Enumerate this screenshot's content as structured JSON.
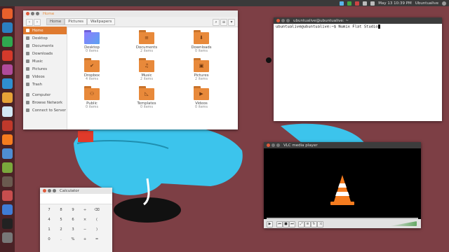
{
  "topbar": {
    "time": "May 13 10:39 PM",
    "user": "Ubuntualive"
  },
  "icons": {
    "launcher": [
      "dash-icon",
      "files-icon",
      "chrome-icon",
      "terminal-icon",
      "writer-icon",
      "calc-icon",
      "impress-icon",
      "software-icon",
      "settings-icon",
      "vlc-icon",
      "screenshot-icon",
      "shotwell-icon",
      "gimp-icon",
      "calculator-icon",
      "inkscape-icon",
      "terminal-icon",
      "trash-icon"
    ],
    "colors": [
      "#e8602c",
      "#2b7fc0",
      "#2fa84f",
      "#d43a2b",
      "#b04b9b",
      "#2f8fcf",
      "#e6a237",
      "#d2e7f4",
      "#c0392b",
      "#f57c1f",
      "#4f8dd2",
      "#7aa83c",
      "#6a5a4f",
      "#c74e4e",
      "#3f7cd6",
      "#222222",
      "#777777"
    ]
  },
  "files": {
    "title": "Home",
    "crumbs": [
      "Home",
      "Pictures",
      "Wallpapers"
    ],
    "sidebar": [
      {
        "label": "Home",
        "icon": "home-icon",
        "selected": true
      },
      {
        "label": "Desktop",
        "icon": "desktop-icon"
      },
      {
        "label": "Documents",
        "icon": "documents-icon"
      },
      {
        "label": "Downloads",
        "icon": "downloads-icon"
      },
      {
        "label": "Music",
        "icon": "music-icon"
      },
      {
        "label": "Pictures",
        "icon": "pictures-icon"
      },
      {
        "label": "Videos",
        "icon": "videos-icon"
      },
      {
        "label": "Trash",
        "icon": "trash-icon"
      },
      {
        "label": "Computer",
        "icon": "computer-icon"
      },
      {
        "label": "Browse Network",
        "icon": "network-icon"
      },
      {
        "label": "Connect to Server",
        "icon": "server-icon"
      }
    ],
    "items": [
      {
        "name": "Desktop",
        "sub": "0 items",
        "icon": "desktop-folder-icon",
        "glyph": ""
      },
      {
        "name": "Documents",
        "sub": "2 items",
        "icon": "documents-folder-icon",
        "glyph": "≡"
      },
      {
        "name": "Downloads",
        "sub": "0 items",
        "icon": "downloads-folder-icon",
        "glyph": "⬇"
      },
      {
        "name": "Dropbox",
        "sub": "4 items",
        "icon": "dropbox-folder-icon",
        "glyph": "✔"
      },
      {
        "name": "Music",
        "sub": "2 items",
        "icon": "music-folder-icon",
        "glyph": "♫"
      },
      {
        "name": "Pictures",
        "sub": "2 items",
        "icon": "pictures-folder-icon",
        "glyph": "▣"
      },
      {
        "name": "Public",
        "sub": "0 items",
        "icon": "public-folder-icon",
        "glyph": "⚇"
      },
      {
        "name": "Templates",
        "sub": "0 items",
        "icon": "templates-folder-icon",
        "glyph": "◺"
      },
      {
        "name": "Videos",
        "sub": "0 items",
        "icon": "videos-folder-icon",
        "glyph": "▶"
      }
    ]
  },
  "terminal": {
    "title": "ubuntualive@ubuntualive: ~",
    "line": "ubuntualive@ubuntualive:~$ Numix Flat Studio"
  },
  "vlc": {
    "title": "VLC media player"
  },
  "calculator": {
    "title": "Calculator",
    "keys": [
      "7",
      "8",
      "9",
      "÷",
      "⌫",
      "4",
      "5",
      "6",
      "×",
      "(",
      "1",
      "2",
      "3",
      "−",
      ")",
      "0",
      ".",
      "%",
      "+",
      "="
    ]
  }
}
